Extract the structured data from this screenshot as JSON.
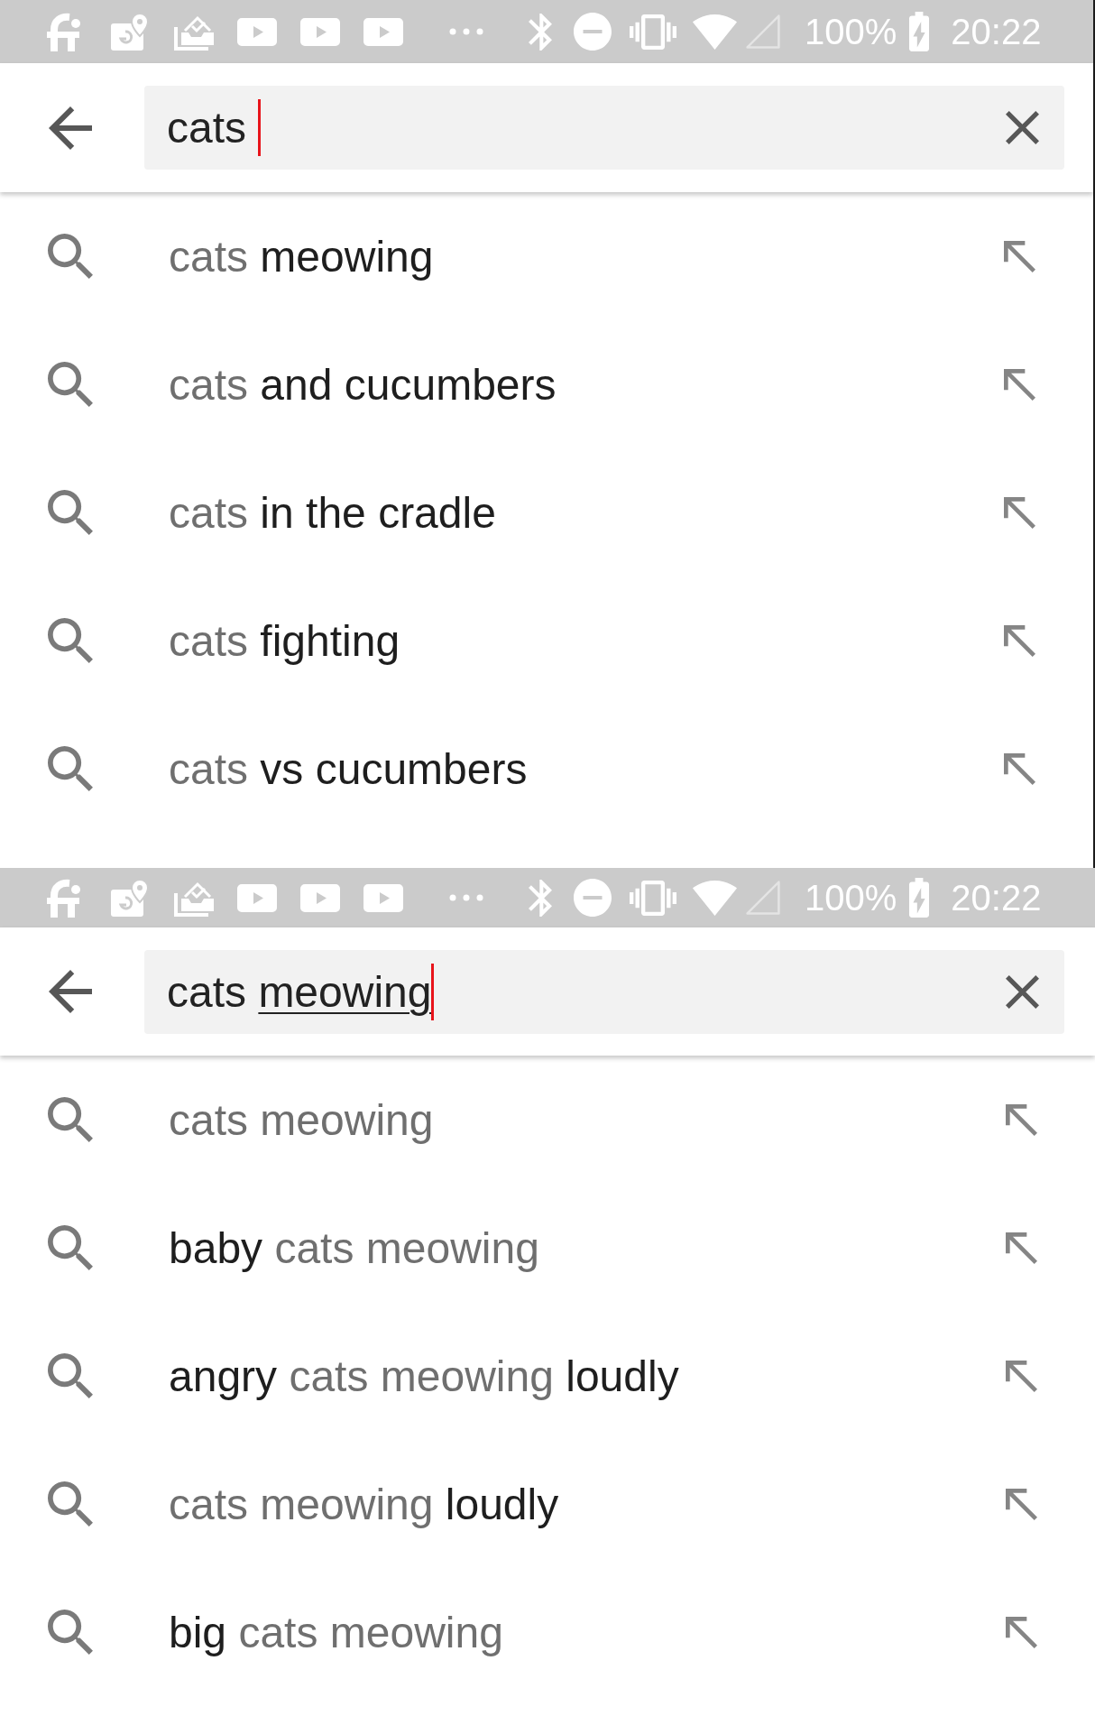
{
  "screens": [
    {
      "status_bar": {
        "battery": "100%",
        "time": "20:22"
      },
      "search": {
        "query": [
          {
            "text": "cats ",
            "underlined": false
          }
        ]
      },
      "suggestions": [
        {
          "parts": [
            {
              "text": "cats",
              "matched": true
            },
            {
              "text": " meowing",
              "matched": false
            }
          ]
        },
        {
          "parts": [
            {
              "text": "cats",
              "matched": true
            },
            {
              "text": " and cucumbers",
              "matched": false
            }
          ]
        },
        {
          "parts": [
            {
              "text": "cats",
              "matched": true
            },
            {
              "text": " in the cradle",
              "matched": false
            }
          ]
        },
        {
          "parts": [
            {
              "text": "cats",
              "matched": true
            },
            {
              "text": " fighting",
              "matched": false
            }
          ]
        },
        {
          "parts": [
            {
              "text": "cats",
              "matched": true
            },
            {
              "text": " vs cucumbers",
              "matched": false
            }
          ]
        }
      ]
    },
    {
      "status_bar": {
        "battery": "100%",
        "time": "20:22"
      },
      "search": {
        "query": [
          {
            "text": "cats ",
            "underlined": false
          },
          {
            "text": "meowing",
            "underlined": true
          }
        ]
      },
      "suggestions": [
        {
          "parts": [
            {
              "text": "cats meowing",
              "matched": true
            }
          ]
        },
        {
          "parts": [
            {
              "text": "baby ",
              "matched": false
            },
            {
              "text": "cats meowing",
              "matched": true
            }
          ]
        },
        {
          "parts": [
            {
              "text": "angry ",
              "matched": false
            },
            {
              "text": "cats meowing",
              "matched": true
            },
            {
              "text": " loudly",
              "matched": false
            }
          ]
        },
        {
          "parts": [
            {
              "text": "cats meowing",
              "matched": true
            },
            {
              "text": " loudly",
              "matched": false
            }
          ]
        },
        {
          "parts": [
            {
              "text": "big ",
              "matched": false
            },
            {
              "text": "cats meowing",
              "matched": true
            }
          ]
        }
      ]
    }
  ]
}
